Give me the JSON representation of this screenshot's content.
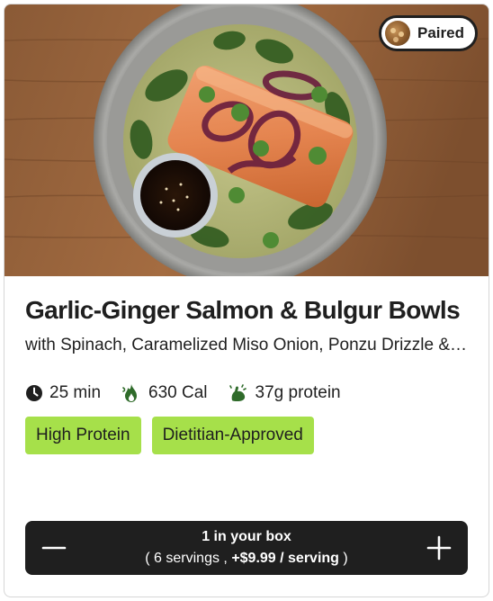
{
  "badge": {
    "label": "Paired",
    "thumb_icon": "food-thumbnail"
  },
  "recipe": {
    "title": "Garlic-Ginger Salmon & Bulgur Bowls",
    "subtitle": "with Spinach, Caramelized Miso Onion, Ponzu Drizzle & Cilantro"
  },
  "meta": {
    "time": "25 min",
    "calories": "630 Cal",
    "protein": "37g protein"
  },
  "tags": [
    "High Protein",
    "Dietitian-Approved"
  ],
  "cart": {
    "quantity_text": "1 in your box",
    "servings_prefix": "( 6 servings ,",
    "price_text": "+$9.99 / serving",
    "servings_suffix": ")",
    "decrement_icon": "minus-icon",
    "increment_icon": "plus-icon"
  },
  "colors": {
    "tag_bg": "#a6e04a",
    "cart_bg": "#1f1f1f",
    "text": "#1f1f1f"
  }
}
